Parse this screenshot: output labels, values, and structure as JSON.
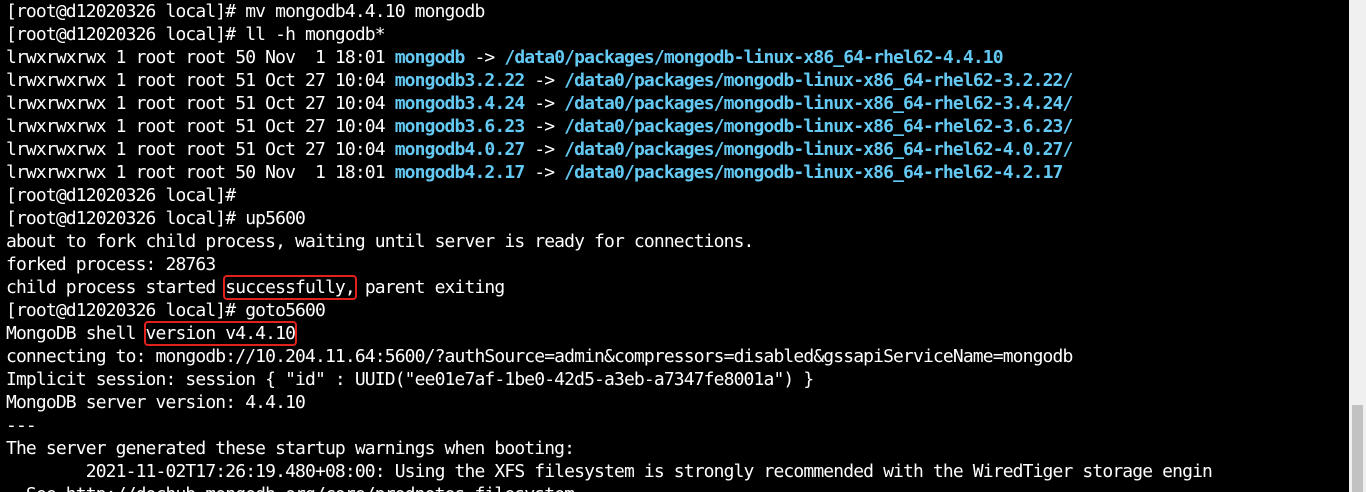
{
  "terminal": {
    "lines": [
      {
        "text": "[root@d12020326 local]# mv mongodb4.4.10 mongodb"
      },
      {
        "pre": "lrwxrwxrwx 1 root root 50 Nov  1 18:01 ",
        "link": "mongodb",
        "arrow": " -> ",
        "target": "/data0/packages/mongodb-linux-x86_64-rhel62-4.4.10"
      },
      {
        "text": "[root@d12020326 local]# ll -h mongodb*"
      }
    ],
    "cmd_mv": "[root@d12020326 local]# mv mongodb4.4.10 mongodb",
    "cmd_ll": "[root@d12020326 local]# ll -h mongodb*",
    "links": [
      {
        "pre": "lrwxrwxrwx 1 root root 50 Nov  1 18:01 ",
        "name": "mongodb",
        "arrow": " -> ",
        "target": "/data0/packages/mongodb-linux-x86_64-rhel62-4.4.10"
      },
      {
        "pre": "lrwxrwxrwx 1 root root 51 Oct 27 10:04 ",
        "name": "mongodb3.2.22",
        "arrow": " -> ",
        "target": "/data0/packages/mongodb-linux-x86_64-rhel62-3.2.22/"
      },
      {
        "pre": "lrwxrwxrwx 1 root root 51 Oct 27 10:04 ",
        "name": "mongodb3.4.24",
        "arrow": " -> ",
        "target": "/data0/packages/mongodb-linux-x86_64-rhel62-3.4.24/"
      },
      {
        "pre": "lrwxrwxrwx 1 root root 51 Oct 27 10:04 ",
        "name": "mongodb3.6.23",
        "arrow": " -> ",
        "target": "/data0/packages/mongodb-linux-x86_64-rhel62-3.6.23/"
      },
      {
        "pre": "lrwxrwxrwx 1 root root 51 Oct 27 10:04 ",
        "name": "mongodb4.0.27",
        "arrow": " -> ",
        "target": "/data0/packages/mongodb-linux-x86_64-rhel62-4.0.27/"
      },
      {
        "pre": "lrwxrwxrwx 1 root root 50 Nov  1 18:01 ",
        "name": "mongodb4.2.17",
        "arrow": " -> ",
        "target": "/data0/packages/mongodb-linux-x86_64-rhel62-4.2.17"
      }
    ],
    "prompt_empty": "[root@d12020326 local]# ",
    "cmd_up": "[root@d12020326 local]# up5600",
    "fork_msg": "about to fork child process, waiting until server is ready for connections.",
    "forked": "forked process: 28763",
    "child_pre": "child process started ",
    "child_hl": "successfully,",
    "child_post": " parent exiting",
    "cmd_goto": "[root@d12020326 local]# goto5600",
    "shell_pre": "MongoDB shell ",
    "shell_hl": "version v4.4.10",
    "connecting": "connecting to: mongodb://10.204.11.64:5600/?authSource=admin&compressors=disabled&gssapiServiceName=mongodb",
    "session": "Implicit session: session { \"id\" : UUID(\"ee01e7af-1be0-42d5-a3eb-a7347fe8001a\") }",
    "server_version": "MongoDB server version: 4.4.10",
    "separator": "---",
    "warnings_header": "The server generated these startup warnings when booting:",
    "warning_line": "        2021-11-02T17:26:19.480+08:00: Using the XFS filesystem is strongly recommended with the WiredTiger storage engin",
    "see_line": "  See http://dochub.mongodb.org/core/prodnotes-filesystem"
  },
  "colors": {
    "background": "#000000",
    "text": "#ffffff",
    "link": "#63c9f3",
    "highlight_box": "#e0211c"
  }
}
